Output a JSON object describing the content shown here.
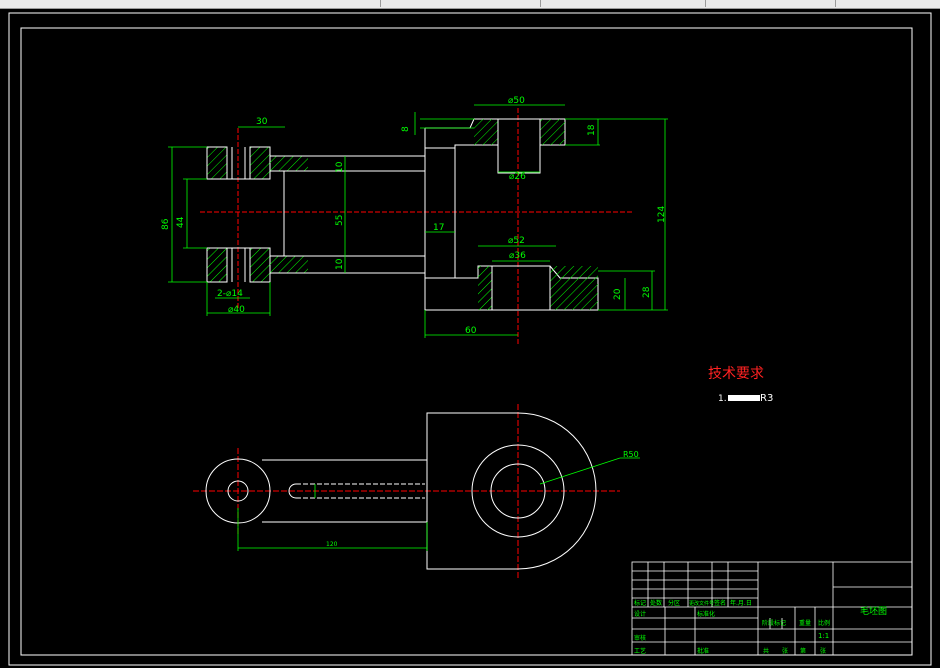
{
  "window": {
    "toolbar_strip": "toolbar"
  },
  "dimensions": {
    "d30": "30",
    "d8": "8",
    "d50_top": "⌀50",
    "d18": "18",
    "d26": "⌀26",
    "d10_a": "10",
    "d86": "86",
    "d44": "44",
    "d55": "55",
    "d124": "124",
    "d17": "17",
    "d10_b": "10",
    "d52": "⌀52",
    "d36": "⌀36",
    "d2x14": "2-⌀14",
    "d20": "20",
    "d28": "28",
    "d40": "⌀40",
    "d60": "60",
    "dR50": "R50",
    "d120": "120"
  },
  "notes": {
    "title": "技术要求",
    "item1_prefix": "1.",
    "item1_suffix": "R3"
  },
  "title_block": {
    "part_name": "毛坯图",
    "scale": "1:1",
    "labels": [
      "标记",
      "处数",
      "分区",
      "更改文件号",
      "签名",
      "年.月.日",
      "设计",
      "标准化",
      "阶段标记",
      "重量",
      "比例",
      "审核",
      "工艺",
      "批准",
      "共",
      "张",
      "第",
      "张"
    ]
  },
  "colors": {
    "line": "#ffffff",
    "dimension": "#00ff00",
    "hatch": "#00ff00",
    "center": "#ff0000",
    "note_title": "#ff2222",
    "frame": "#ffffff"
  }
}
